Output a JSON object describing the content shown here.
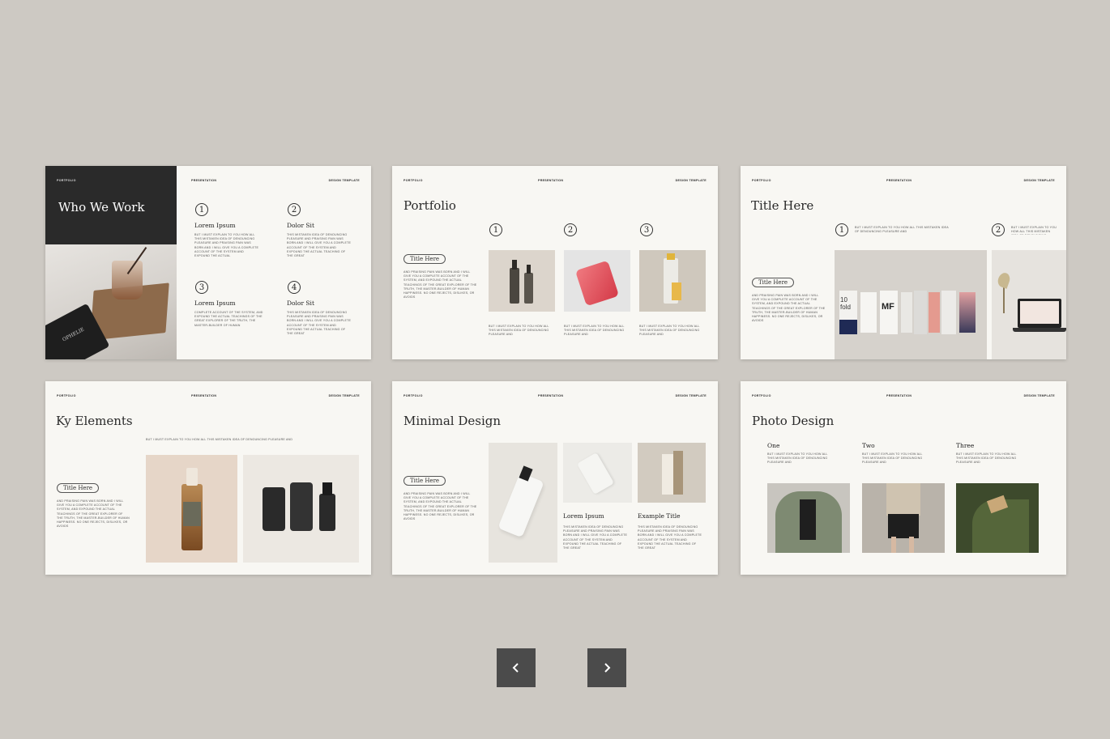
{
  "header": {
    "left": "PORTFOLIO",
    "center": "PRESENTATION",
    "right": "DESIGN TEMPLATE"
  },
  "lorem": {
    "short": "BUT I MUST EXPLAIN TO YOU HOW ALL THIS MISTAKEN IDEA OF DENOUNCING PLEASURE AND",
    "long": "AND PRAISING PAIN WAS BORN AND I WILL GIVE YOU A COMPLETE ACCOUNT OF THE SYSTEM, AND EXPOUND THE ACTUAL TEACHINGS OF THE GREAT EXPLORER OF THE TRUTH, THE MASTER-BUILDER OF HUMAN HAPPINESS. NO ONE REJECTS, DISLIKES, OR AVOIDS",
    "item": "BUT I MUST EXPLAIN TO YOU HOW ALL THIS MISTAKEN IDEA OF DENOUNCING PLEASURE AND PRAISING PAIN WAS BORN AND I WILL GIVE YOU A COMPLETE ACCOUNT OF THE SYSTEM AND EXPOUND THE ACTUAL",
    "item2": "COMPLETE ACCOUNT OF THE SYSTEM, AND EXPOUND THE ACTUAL TEACHINGS OF THE GREAT EXPLORER OF THE TRUTH, THE MASTER-BUILDER OF HUMAN",
    "item3": "THIS MISTAKEN IDEA OF DENOUNCING PLEASURE AND PRAISING PAIN WAS BORN AND I WILL GIVE YOU A COMPLETE ACCOUNT OF THE SYSTEM AND EXPOUND THE ACTUAL TEACHING OF THE GREAT",
    "caption": "BUT I MUST EXPLAIN TO YOU HOW ALL THIS MISTAKEN IDEA OF DENOUNCING PLEASURE AND"
  },
  "slides": {
    "s1": {
      "title": "Who We Work",
      "items": [
        {
          "num": "1",
          "label": "Lorem Ipsum"
        },
        {
          "num": "2",
          "label": "Dolor Sit"
        },
        {
          "num": "3",
          "label": "Lorem Ipsum"
        },
        {
          "num": "4",
          "label": "Dolor Sit"
        }
      ],
      "device_text": "OPHELIE"
    },
    "s2": {
      "title": "Portfolio",
      "pill": "Title Here",
      "nums": [
        "1",
        "2",
        "3"
      ]
    },
    "s3": {
      "title": "Title Here",
      "pill": "Title Here",
      "nums": [
        "1",
        "2"
      ],
      "brand1": "10 fold",
      "brand2": "MF"
    },
    "s4": {
      "title": "Ky Elements",
      "pill": "Title Here"
    },
    "s5": {
      "title": "Minimal Design",
      "pill": "Title Here",
      "labels": [
        "Lorem Ipsum",
        "Example Title"
      ]
    },
    "s6": {
      "title": "Photo Design",
      "cols": [
        "One",
        "Two",
        "Three"
      ]
    }
  },
  "nav": {
    "prev_icon": "chevron-left-icon",
    "next_icon": "chevron-right-icon"
  },
  "colors": {
    "background": "#cdc9c3",
    "slide": "#f8f7f3",
    "dark_panel": "#2a2a2a",
    "nav_button": "#4b4b4b"
  }
}
